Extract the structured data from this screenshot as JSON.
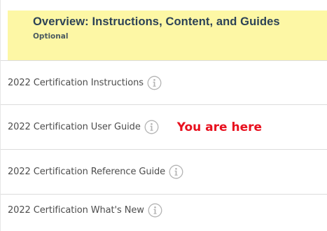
{
  "header": {
    "title": "Overview: Instructions, Content, and Guides",
    "subtitle": "Optional"
  },
  "items": [
    {
      "label": "2022 Certification Instructions",
      "icon": "info-icon"
    },
    {
      "label": "2022 Certification User Guide",
      "icon": "info-icon",
      "annotation": "You are here"
    },
    {
      "label": "2022 Certification Reference Guide",
      "icon": "info-icon"
    },
    {
      "label": "2022 Certification What's New",
      "icon": "info-icon"
    }
  ],
  "colors": {
    "header_bg": "#fdf7a5",
    "header_title": "#2c4256",
    "annotation": "#e8101e",
    "text": "#4d4d4d",
    "divider": "#dcdcdc",
    "icon": "#b4b4b4"
  }
}
